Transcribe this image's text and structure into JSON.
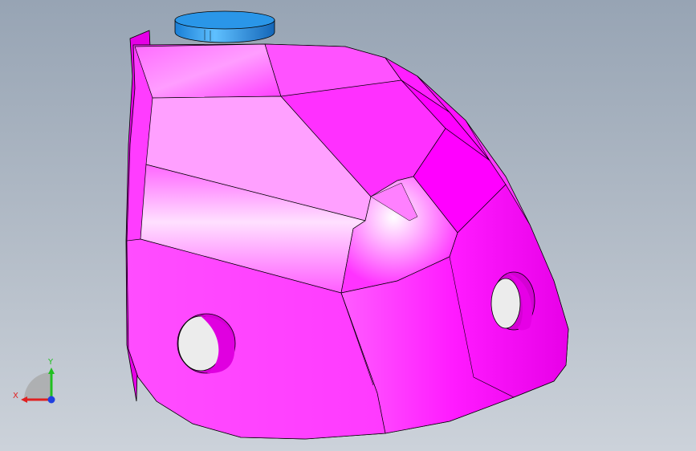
{
  "viewport": {
    "background_top": "#97a4b4",
    "background_bottom": "#ccd2da"
  },
  "model": {
    "body_color": "#ff00ff",
    "highlight_color": "#ffb3ff",
    "cap_color": "#1e90e0"
  },
  "triad": {
    "x_label": "X",
    "y_label": "Y",
    "x_color": "#e02020",
    "y_color": "#20c020",
    "z_color": "#2040e0"
  }
}
